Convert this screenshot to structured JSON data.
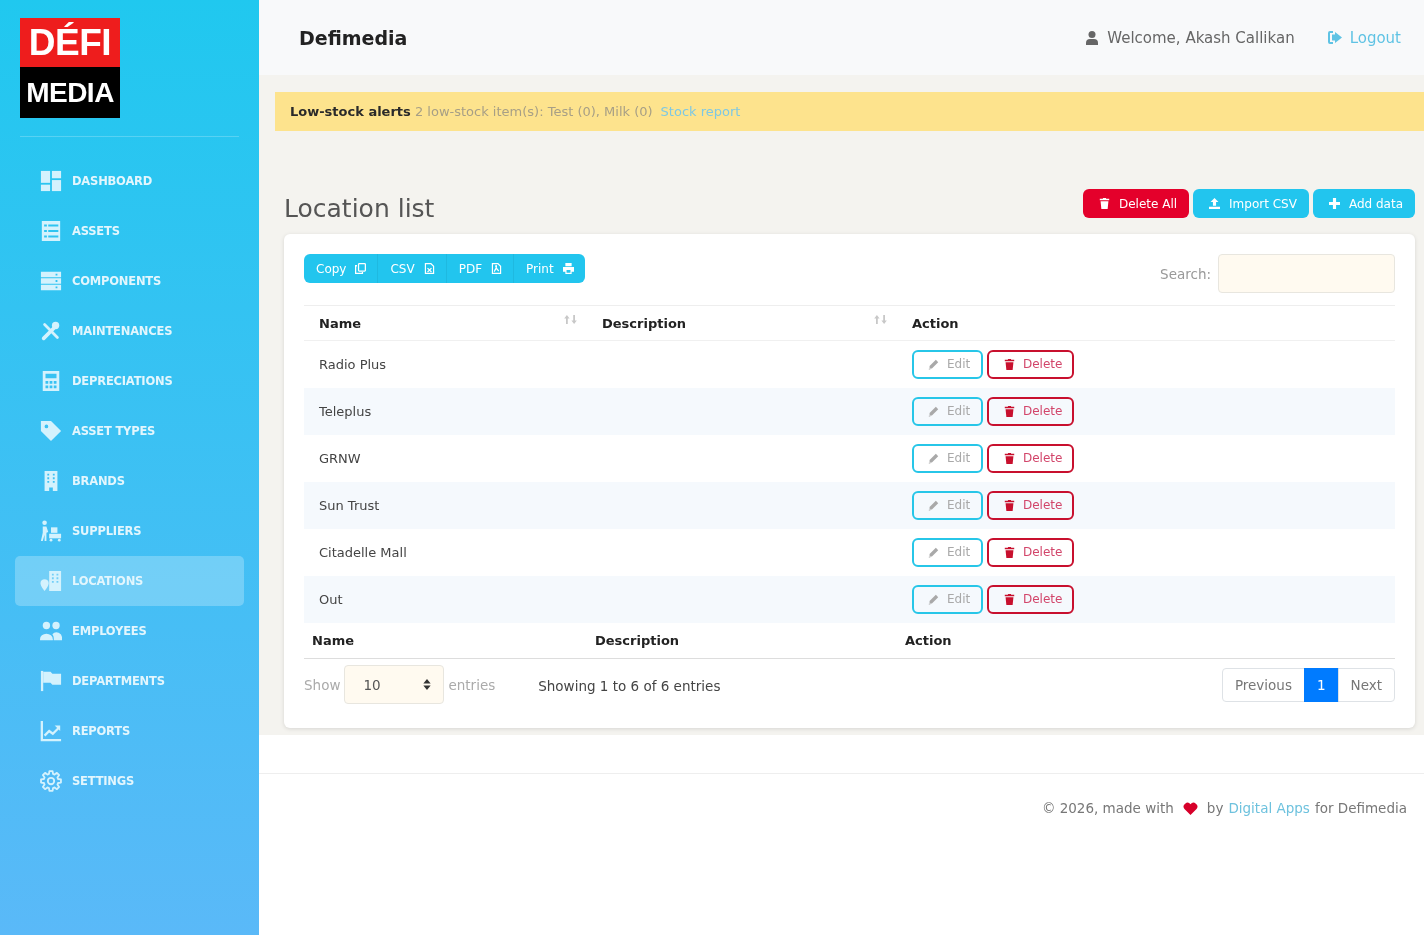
{
  "sidebar": {
    "logo": {
      "top": "DÉFI",
      "bottom": "MEDIA"
    },
    "items": [
      {
        "label": "DASHBOARD",
        "selected": false
      },
      {
        "label": "ASSETS",
        "selected": false
      },
      {
        "label": "COMPONENTS",
        "selected": false
      },
      {
        "label": "MAINTENANCES",
        "selected": false
      },
      {
        "label": "DEPRECIATIONS",
        "selected": false
      },
      {
        "label": "ASSET TYPES",
        "selected": false
      },
      {
        "label": "BRANDS",
        "selected": false
      },
      {
        "label": "SUPPLIERS",
        "selected": false
      },
      {
        "label": "LOCATIONS",
        "selected": true
      },
      {
        "label": "EMPLOYEES",
        "selected": false
      },
      {
        "label": "DEPARTMENTS",
        "selected": false
      },
      {
        "label": "REPORTS",
        "selected": false
      },
      {
        "label": "SETTINGS",
        "selected": false
      }
    ]
  },
  "header": {
    "title": "Defimedia",
    "welcome": "Welcome, Akash Callikan",
    "logout": "Logout"
  },
  "alert": {
    "message": "**Low-stock alerts** 2 low-stock item(s): Test (0), Milk (0)",
    "link": "Stock report"
  },
  "page_title": "Location list",
  "actions": [
    {
      "label": "Delete All",
      "kind": "danger"
    },
    {
      "label": "Import CSV",
      "kind": "info"
    },
    {
      "label": "Add data",
      "kind": "info"
    }
  ],
  "export_buttons": [
    "Copy",
    "CSV",
    "PDF",
    "Print"
  ],
  "search": {
    "label": "Search:"
  },
  "table": {
    "columns": [
      {
        "label": "Name",
        "sortable": true
      },
      {
        "label": "Description",
        "sortable": true
      },
      {
        "label": "Action",
        "sortable": false
      }
    ],
    "rows": [
      {
        "name": "Radio Plus",
        "edit": "Edit",
        "delete": "Delete"
      },
      {
        "name": "Teleplus",
        "edit": "Edit",
        "delete": "Delete"
      },
      {
        "name": "GRNW",
        "edit": "Edit",
        "delete": "Delete"
      },
      {
        "name": "Sun Trust",
        "edit": "Edit",
        "delete": "Delete"
      },
      {
        "name": "Citadelle Mall",
        "edit": "Edit",
        "delete": "Delete"
      },
      {
        "name": "Out",
        "edit": "Edit",
        "delete": "Delete"
      }
    ],
    "footer": [
      "Name",
      "Description",
      "Action"
    ]
  },
  "length": {
    "show": "Show",
    "value": "10",
    "entries": "entries"
  },
  "info": "Showing 1 to 6 of 6 entries",
  "pagination": [
    {
      "label": "Previous",
      "selected": false
    },
    {
      "label": "1",
      "selected": true
    },
    {
      "label": "Next",
      "selected": false
    }
  ],
  "footer": {
    "credit": "© 2026, made with",
    "by": "by",
    "link": "Digital Apps",
    "suffix": "for Defimedia"
  }
}
